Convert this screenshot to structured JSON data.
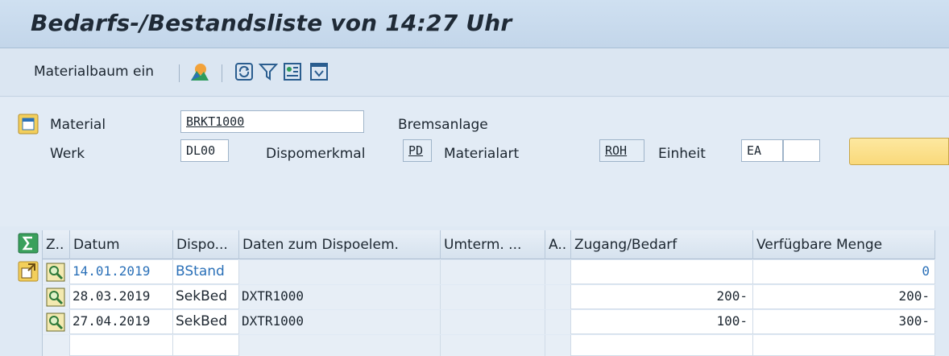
{
  "title": "Bedarfs-/Bestandsliste von 14:27 Uhr",
  "toolbar": {
    "materialbaum_label": "Materialbaum ein",
    "icons": [
      "chart-icon",
      "refresh-icon",
      "filter-icon",
      "details-icon",
      "collapse-icon"
    ]
  },
  "header": {
    "material_label": "Material",
    "material_value": "BRKT1000",
    "material_desc": "Bremsanlage",
    "werk_label": "Werk",
    "werk_value": "DL00",
    "dispomerkmal_label": "Dispomerkmal",
    "dispomerkmal_value": "PD",
    "materialart_label": "Materialart",
    "materialart_value": "ROH",
    "einheit_label": "Einheit",
    "einheit_value": "EA",
    "einheit_extra": ""
  },
  "table": {
    "columns": [
      "Z..",
      "Datum",
      "Dispo...",
      "Daten zum Dispoelem.",
      "Umterm. ...",
      "A..",
      "Zugang/Bedarf",
      "Verfügbare Menge"
    ],
    "rows": [
      {
        "datum": "14.01.2019",
        "dispo": "BStand",
        "daten": "",
        "umterm": "",
        "a": "",
        "zugang": "",
        "menge": "0"
      },
      {
        "datum": "28.03.2019",
        "dispo": "SekBed",
        "daten": "DXTR1000",
        "umterm": "",
        "a": "",
        "zugang": "200-",
        "menge": "200-"
      },
      {
        "datum": "27.04.2019",
        "dispo": "SekBed",
        "daten": "DXTR1000",
        "umterm": "",
        "a": "",
        "zugang": "100-",
        "menge": "300-"
      }
    ]
  },
  "colors": {
    "accent_blue": "#2a70b8",
    "title_bg": "#c3d6ea",
    "button_yellow": "#f9d97a"
  }
}
